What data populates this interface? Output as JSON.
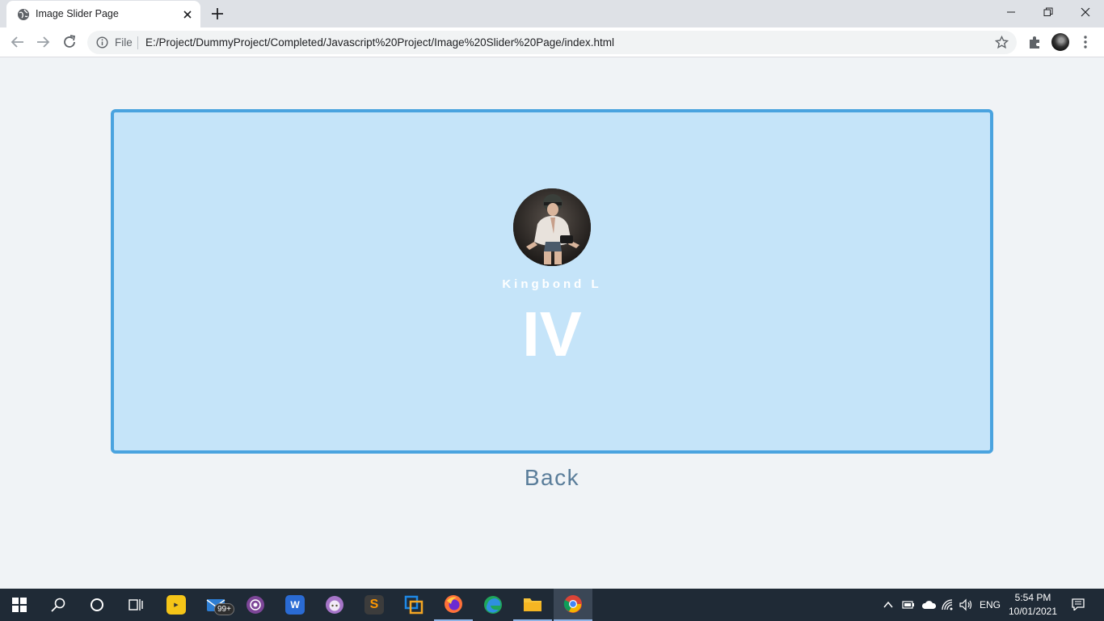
{
  "browser": {
    "tab_title": "Image Slider Page",
    "scheme_label": "File",
    "url": "E:/Project/DummyProject/Completed/Javascript%20Project/Image%20Slider%20Page/index.html"
  },
  "slider": {
    "user_name": "Kingbond L",
    "slide_number": "IV",
    "back_label": "Back"
  },
  "taskbar": {
    "apps": [
      "start",
      "search",
      "cortana",
      "task-view",
      "player",
      "mail",
      "tor-browser",
      "wps",
      "github-desktop",
      "sublime-text",
      "virtualbox",
      "firefox",
      "edge",
      "file-explorer",
      "chrome"
    ],
    "mail_badge": "99+",
    "language": "ENG",
    "time": "5:54 PM",
    "date": "10/01/2021"
  },
  "colors": {
    "card_bg": "#c5e4f9",
    "card_border": "#4aa3df",
    "page_bg": "#f0f3f6",
    "back_text": "#5a7d9a",
    "taskbar_bg": "#1f2a36"
  }
}
